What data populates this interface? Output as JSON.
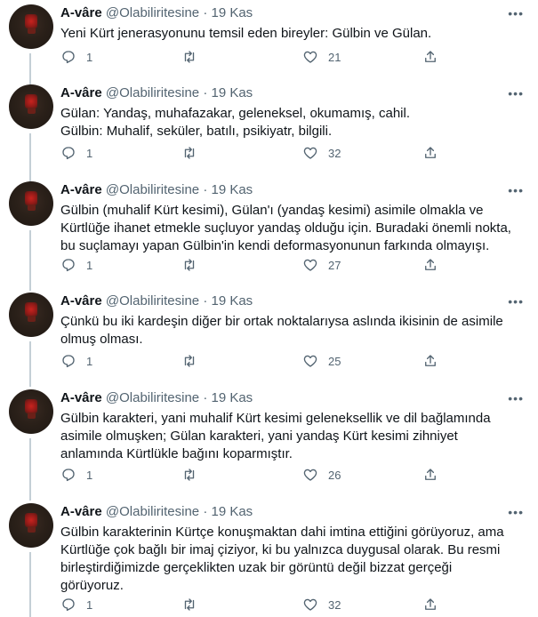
{
  "tweets": [
    {
      "name": "A-vâre",
      "handle": "@Olabiliritesine",
      "separator": "·",
      "date": "19 Kas",
      "text": "Yeni Kürt jenerasyonunu temsil eden bireyler: Gülbin ve Gülan.",
      "replies": "1",
      "retweets": "",
      "likes": "21"
    },
    {
      "name": "A-vâre",
      "handle": "@Olabiliritesine",
      "separator": "·",
      "date": "19 Kas",
      "text": "Gülan: Yandaş, muhafazakar, geleneksel, okumamış, cahil.\nGülbin: Muhalif, seküler, batılı, psikiyatr, bilgili.",
      "replies": "1",
      "retweets": "",
      "likes": "32"
    },
    {
      "name": "A-vâre",
      "handle": "@Olabiliritesine",
      "separator": "·",
      "date": "19 Kas",
      "text": "Gülbin (muhalif Kürt kesimi), Gülan'ı (yandaş kesimi) asimile olmakla ve\nKürtlüğe ihanet etmekle suçluyor yandaş olduğu için. Buradaki önemli nokta,\nbu suçlamayı yapan Gülbin'in kendi deformasyonunun farkında olmayışı.",
      "replies": "1",
      "retweets": "",
      "likes": "27"
    },
    {
      "name": "A-vâre",
      "handle": "@Olabiliritesine",
      "separator": "·",
      "date": "19 Kas",
      "text": "Çünkü bu iki kardeşin diğer bir ortak noktalarıysa aslında ikisinin de asimile\nolmuş olması.",
      "replies": "1",
      "retweets": "",
      "likes": "25"
    },
    {
      "name": "A-vâre",
      "handle": "@Olabiliritesine",
      "separator": "·",
      "date": "19 Kas",
      "text": "Gülbin karakteri, yani muhalif Kürt kesimi geleneksellik ve dil bağlamında\nasimile olmuşken; Gülan karakteri, yani yandaş Kürt kesimi zihniyet\nanlamında Kürtlükle bağını koparmıştır.",
      "replies": "1",
      "retweets": "",
      "likes": "26"
    },
    {
      "name": "A-vâre",
      "handle": "@Olabiliritesine",
      "separator": "·",
      "date": "19 Kas",
      "text": "Gülbin karakterinin Kürtçe konuşmaktan dahi imtina ettiğini görüyoruz, ama\nKürtlüğe çok bağlı bir imaj çiziyor, ki bu yalnızca duygusal olarak. Bu resmi\nbirleştirdiğimizde gerçeklikten uzak bir görüntü değil bizzat gerçeği\ngörüyoruz.",
      "replies": "1",
      "retweets": "",
      "likes": "32"
    }
  ],
  "icons": {
    "reply": "reply-icon",
    "retweet": "retweet-icon",
    "like": "heart-icon",
    "share": "share-icon",
    "more": "more-icon"
  },
  "colors": {
    "text": "#0f1419",
    "secondary": "#536471",
    "thread_line": "#c4cfd6"
  }
}
